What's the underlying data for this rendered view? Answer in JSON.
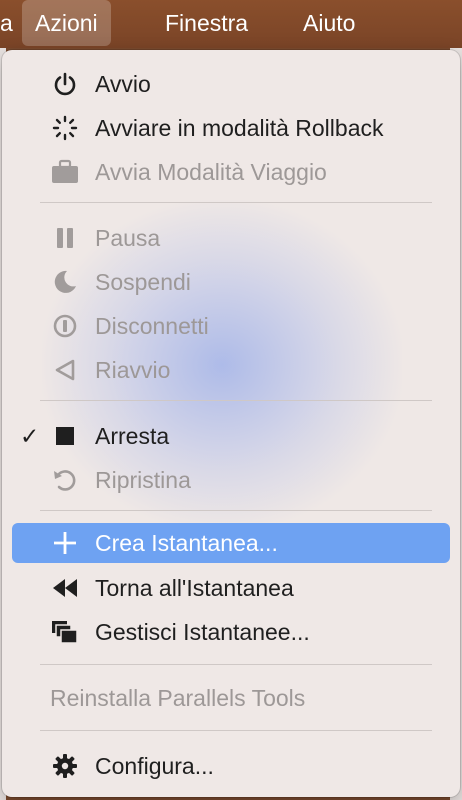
{
  "menubar": {
    "items": [
      {
        "label": "a"
      },
      {
        "label": "Azioni"
      },
      {
        "label": "Finestra"
      },
      {
        "label": "Aiuto"
      }
    ]
  },
  "menu": {
    "items": [
      {
        "label": "Avvio",
        "icon": "power-icon",
        "enabled": true
      },
      {
        "label": "Avviare in modalità Rollback",
        "icon": "spinner-icon",
        "enabled": true
      },
      {
        "label": "Avvia Modalità Viaggio",
        "icon": "briefcase-icon",
        "enabled": false
      },
      {
        "label": "Pausa",
        "icon": "pause-icon",
        "enabled": false
      },
      {
        "label": "Sospendi",
        "icon": "moon-icon",
        "enabled": false
      },
      {
        "label": "Disconnetti",
        "icon": "disconnect-icon",
        "enabled": false
      },
      {
        "label": "Riavvio",
        "icon": "restart-triangle-icon",
        "enabled": false
      },
      {
        "label": "Arresta",
        "icon": "stop-square-icon",
        "enabled": true,
        "checked": true,
        "check_mark": "✓"
      },
      {
        "label": "Ripristina",
        "icon": "undo-icon",
        "enabled": false
      },
      {
        "label": "Crea Istantanea...",
        "icon": "plus-icon",
        "enabled": true,
        "highlighted": true
      },
      {
        "label": "Torna all'Istantanea",
        "icon": "rewind-icon",
        "enabled": true
      },
      {
        "label": "Gestisci Istantanee...",
        "icon": "stacked-windows-icon",
        "enabled": true
      },
      {
        "label": "Reinstalla Parallels Tools",
        "icon": null,
        "enabled": false
      },
      {
        "label": "Configura...",
        "icon": "gear-icon",
        "enabled": true
      }
    ]
  },
  "colors": {
    "menubar": "#7a4427",
    "menu_bg": "#efe8e6",
    "highlight": "#6ea2f2",
    "text": "#1f1f1f",
    "disabled_text": "#9d9897"
  }
}
